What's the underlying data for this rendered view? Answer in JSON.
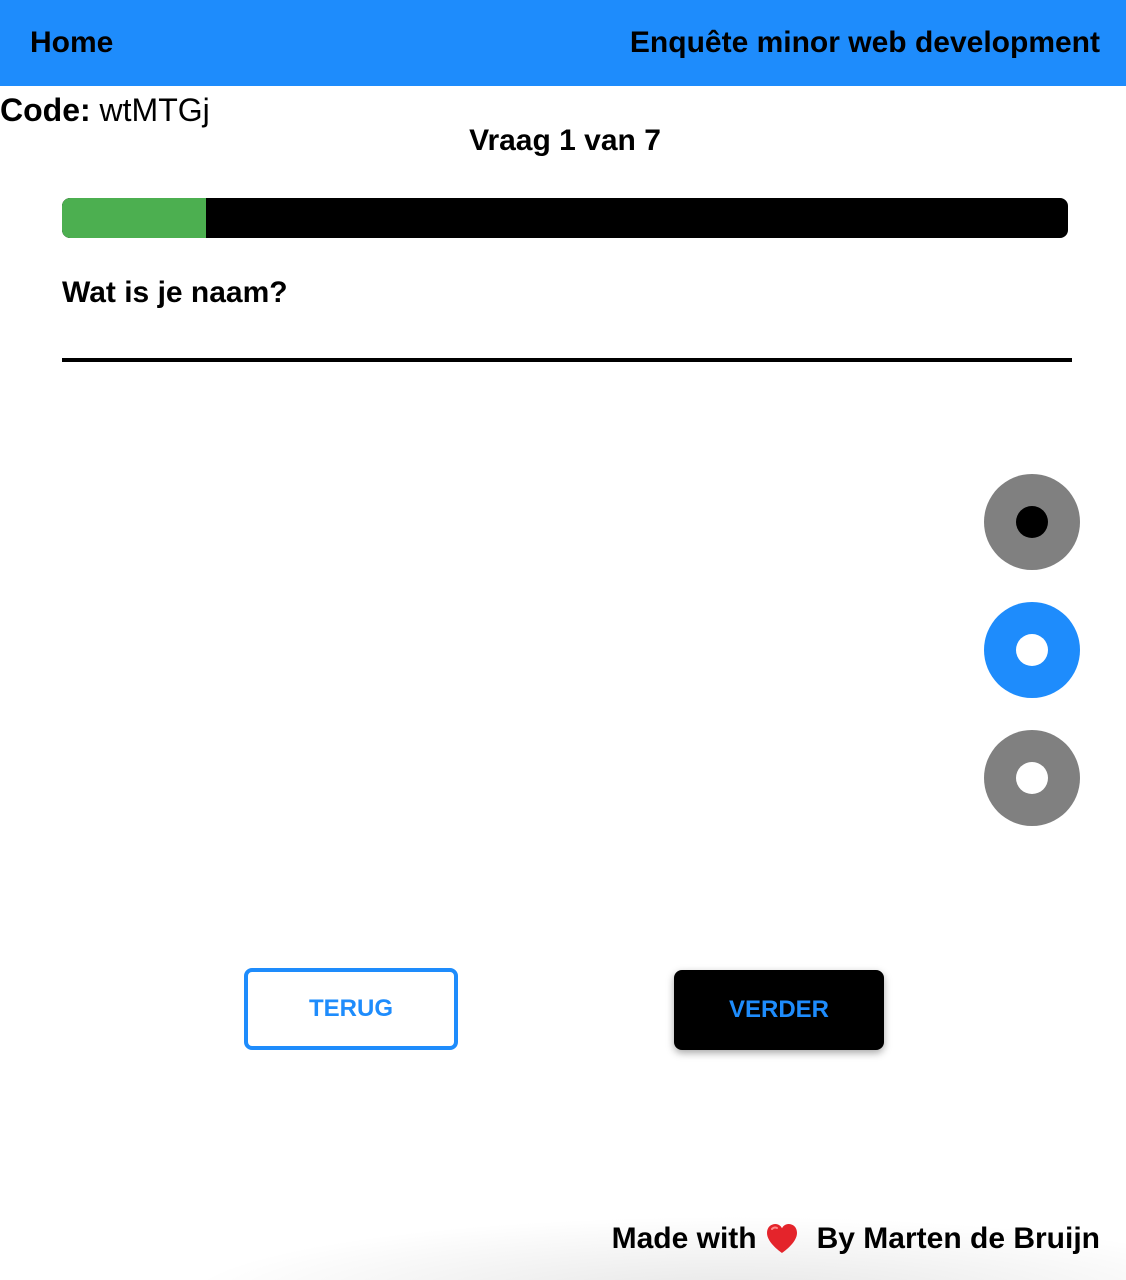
{
  "header": {
    "home_label": "Home",
    "title": "Enquête minor web development"
  },
  "code": {
    "label": "Code:",
    "value": "wtMTGj"
  },
  "progress": {
    "counter_text": "Vraag 1 van 7",
    "fraction": 0.143
  },
  "question": {
    "label": "Wat is je naam?",
    "answer_value": ""
  },
  "nav_dots": [
    {
      "state": "active",
      "color": "#808080",
      "inner_color": "#000000"
    },
    {
      "state": "highlight",
      "color": "#1e8cfc",
      "inner_color": "#ffffff"
    },
    {
      "state": "inactive",
      "color": "#808080",
      "inner_color": "#ffffff"
    }
  ],
  "buttons": {
    "back_label": "TERUG",
    "next_label": "VERDER"
  },
  "footer": {
    "made_with": "Made with",
    "heart_icon": "heart-icon",
    "by_text": "By Marten de Bruijn"
  },
  "colors": {
    "accent": "#1e8cfc",
    "progress_fill": "#4caf50",
    "progress_track": "#000000"
  }
}
